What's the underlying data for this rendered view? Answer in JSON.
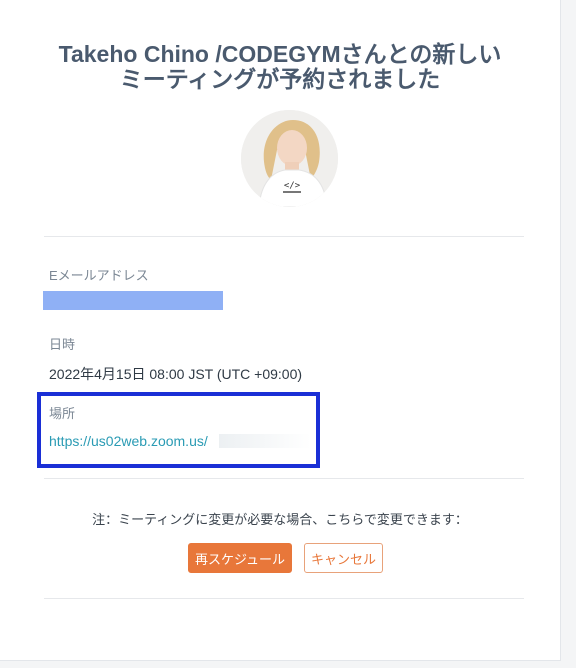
{
  "header": {
    "title_line1": "Takeho Chino /CODEGYMさんとの新しい",
    "title_line2": "ミーティングが予約されました"
  },
  "fields": {
    "email_label": "Eメールアドレス",
    "datetime_label": "日時",
    "datetime_value": "2022年4月15日 08:00 JST (UTC +09:00)",
    "location_label": "場所",
    "location_link": "https://us02web.zoom.us/"
  },
  "footer": {
    "note": "注：ミーティングに変更が必要な場合、こちらで変更できます：",
    "reschedule_label": "再スケジュール",
    "cancel_label": "キャンセル"
  },
  "colors": {
    "accent": "#e8773a",
    "link": "#2a9bb4",
    "highlight_box": "#1a2fd6",
    "redaction": "#8fb0f5"
  }
}
